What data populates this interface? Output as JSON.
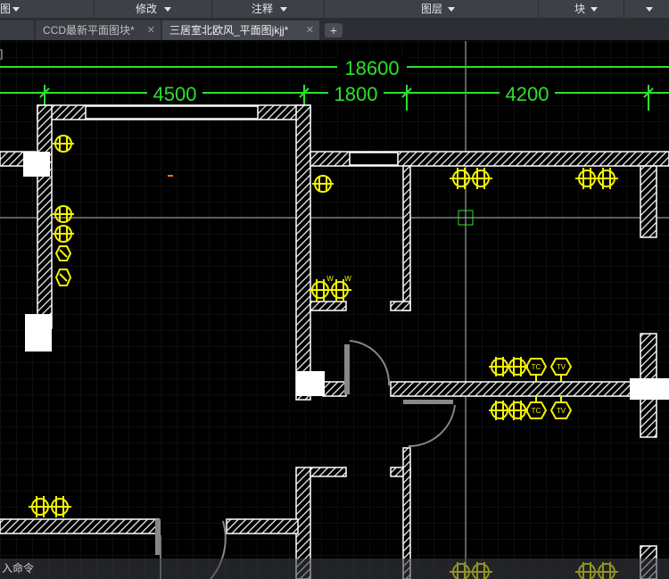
{
  "ribbon": {
    "items": [
      {
        "label": "图"
      },
      {
        "label": "修改"
      },
      {
        "label": "注释"
      },
      {
        "label": "图层"
      },
      {
        "label": "块"
      }
    ]
  },
  "tabs": [
    {
      "label": "CCD最新平面图块*",
      "close": "✕"
    },
    {
      "label": "三居室北欧风_平面图jkjj*",
      "close": "✕"
    }
  ],
  "tab_add": "+",
  "viewport_label": "]",
  "dimensions": {
    "overall": "18600",
    "d1": "4500",
    "d2": "1800",
    "d3": "4200"
  },
  "symbols": {
    "tc": "TC",
    "tv": "TV",
    "w": "W"
  },
  "command_line": {
    "prompt": "入命令"
  },
  "colors": {
    "dimension": "#2de02d",
    "symbol": "#f3f300",
    "wall": "#ffffff",
    "grid": "#1b1b1b",
    "door": "#888888",
    "crosshair": "#c8c8c8"
  }
}
